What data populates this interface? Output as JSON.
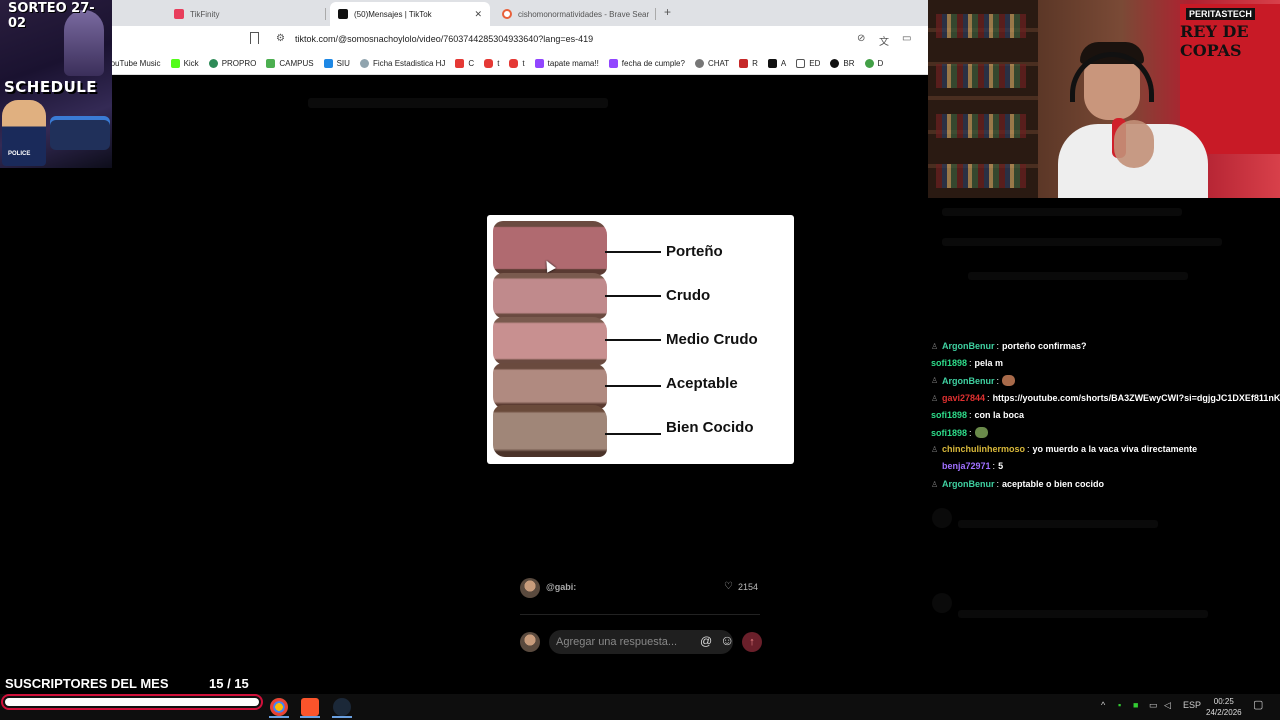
{
  "stream_overlay": {
    "sorteo_label": "SORTEO 27-02",
    "schedule_label": "SCHEDULE",
    "police_label": "POLICE"
  },
  "browser": {
    "tabs": [
      {
        "label": "TikFinity",
        "fav_color": "#e83e5c"
      },
      {
        "label": "(50)Mensajes | TikTok",
        "fav_color": "#111111"
      },
      {
        "label": "cishomonormatividades - Brave Sear",
        "fav_color": "#e8603a"
      }
    ],
    "new_tab_symbol": "+",
    "close_symbol": "✕",
    "url": "tiktok.com/@somosnachoylolo/video/7603744285304933640?lang=es-419",
    "bookmarks": [
      {
        "label": "YouTube Music",
        "color": "#ff0000"
      },
      {
        "label": "Kick",
        "color": "#53fc18"
      },
      {
        "label": "PROPRO",
        "color": "#2e8b57"
      },
      {
        "label": "CAMPUS",
        "color": "#4caf50"
      },
      {
        "label": "SIU",
        "color": "#1e88e5"
      },
      {
        "label": "Ficha Estadistica HJ",
        "color": "#90a4ae"
      },
      {
        "label": "C",
        "color": "#e53935"
      },
      {
        "label": "t",
        "color": "#e53935"
      },
      {
        "label": "t",
        "color": "#e53935"
      },
      {
        "label": "tapate mama!!",
        "color": "#9146ff"
      },
      {
        "label": "fecha de cumple?",
        "color": "#9146ff"
      },
      {
        "label": "CHAT",
        "color": "#777777"
      },
      {
        "label": "R",
        "color": "#c62828"
      },
      {
        "label": "A",
        "color": "#111111"
      },
      {
        "label": "ED",
        "color": "#555555"
      },
      {
        "label": "BR",
        "color": "#111111"
      },
      {
        "label": "D",
        "color": "#43a047"
      }
    ]
  },
  "steak_image": {
    "labels": [
      "Porteño",
      "Crudo",
      "Medio Crudo",
      "Aceptable",
      "Bien Cocido"
    ]
  },
  "comment": {
    "user": "@gabi:",
    "likes": "2154",
    "reply_placeholder": "Agregar una respuesta..."
  },
  "webcam": {
    "flag_text_1": "PERITASTECH",
    "flag_text_2": "REY DE COPAS"
  },
  "chat": {
    "messages": [
      {
        "badge": "♙",
        "user": "ArgonBenur",
        "color": "#3fd0a0",
        "text": "porteño confirmas?"
      },
      {
        "badge": "",
        "user": "sofi1898",
        "color": "#2edc8a",
        "text": "pela m"
      },
      {
        "badge": "♙",
        "user": "ArgonBenur",
        "color": "#3fd0a0",
        "text": "",
        "emote_color": "#a86a4a"
      },
      {
        "badge": "♙",
        "user": "gavi27844",
        "color": "#e03030",
        "text": "https://youtube.com/shorts/BA3ZWEwyCWI?si=dgjgJC1DXEf811nK"
      },
      {
        "badge": "",
        "user": "sofi1898",
        "color": "#2edc8a",
        "text": "con la boca"
      },
      {
        "badge": "",
        "user": "sofi1898",
        "color": "#2edc8a",
        "text": "",
        "emote_color": "#6a8a4a"
      },
      {
        "badge": "♙",
        "user": "chinchulinhermoso",
        "color": "#d8b83a",
        "text": "yo muerdo a la vaca viva directamente"
      },
      {
        "badge": "",
        "user": "benja72971",
        "color": "#a070ff",
        "text": "5"
      },
      {
        "badge": "♙",
        "user": "ArgonBenur",
        "color": "#3fd0a0",
        "text": "aceptable o bien cocido"
      }
    ]
  },
  "subs": {
    "label": "SUSCRIPTORES DEL MES",
    "count": "15  / 15",
    "progress": 1.0
  },
  "taskbar": {
    "lang": "ESP",
    "time": "00:25",
    "date": "24/2/2026"
  },
  "colors": {
    "accent_red": "#d0103a"
  }
}
